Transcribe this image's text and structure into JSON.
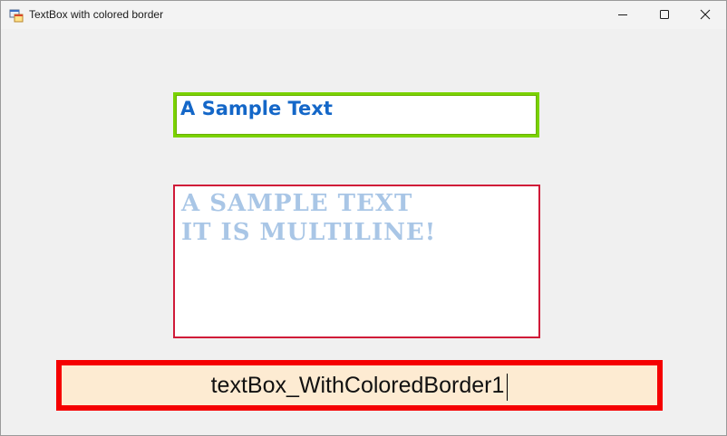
{
  "window": {
    "title": "TextBox with colored border",
    "icon": "winforms-app-icon",
    "controls": {
      "minimize_icon": "minimize-icon",
      "maximize_icon": "maximize-icon",
      "close_icon": "close-icon"
    }
  },
  "textboxes": {
    "single": {
      "value": "A Sample Text",
      "border_color": "#7ad200",
      "text_color": "#1467c8",
      "background": "#ffffff"
    },
    "multiline": {
      "lines": [
        "A SAMPLE TEXT",
        "IT IS MULTILINE!"
      ],
      "border_color": "#d01a38",
      "text_color": "#a9c6e6",
      "background": "#ffffff"
    },
    "focused": {
      "value": "textBox_WithColoredBorder1",
      "border_color": "#f50000",
      "text_color": "#111111",
      "background": "#fdebd2"
    }
  }
}
